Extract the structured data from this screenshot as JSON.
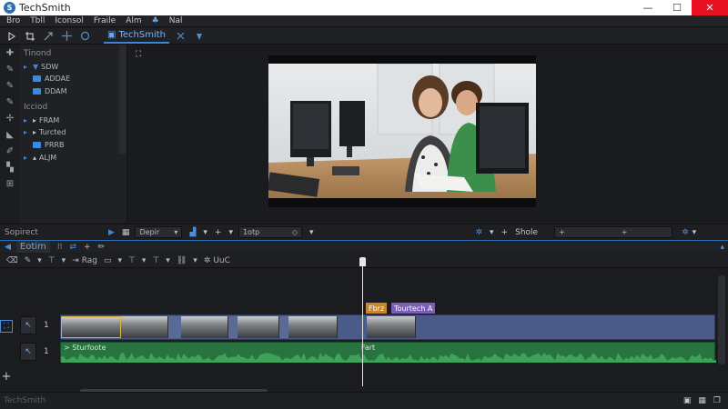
{
  "window": {
    "title": "TechSmith",
    "logo_glyph": "S",
    "controls": {
      "minimize": "—",
      "maximize": "☐",
      "close": "✕"
    }
  },
  "menu": {
    "items": [
      "Bro",
      "Tbll",
      "Iconsol",
      "Fraile",
      "Alm"
    ],
    "extra_icon": "♣",
    "extra_label": "Nal"
  },
  "toolbar": {
    "tab_label": "TechSmith",
    "icons": [
      "arrow-icon",
      "crop-icon",
      "pan-icon",
      "move-icon",
      "zoom-icon"
    ]
  },
  "media_bin": {
    "sections": [
      {
        "label": "Tinond",
        "rows": [
          {
            "label": "SDW",
            "type": "file"
          },
          {
            "label": "ADDAE",
            "type": "folder"
          },
          {
            "label": "DDAM",
            "type": "folder"
          }
        ]
      },
      {
        "label": "Icciod",
        "rows": [
          {
            "label": "FRAM",
            "type": "file"
          },
          {
            "label": "Turcted",
            "type": "file"
          },
          {
            "label": "PRRB",
            "type": "folder"
          },
          {
            "label": "ALJM",
            "type": "file"
          }
        ]
      }
    ]
  },
  "props_bar": {
    "label": "Sopirect",
    "field1": "Depir",
    "field2": "1otp",
    "share_label": "Shole"
  },
  "timeline": {
    "tab_label": "Eotim",
    "toolbar_label_rag": "Rag",
    "toolbar_label_uuc": "UuC",
    "tracks": [
      {
        "number": "1",
        "kind": "video"
      },
      {
        "number": "1",
        "kind": "audio",
        "label": "Sturfoote"
      }
    ],
    "clip_tags": [
      {
        "label": "Fbrz",
        "color": "#c9852b"
      },
      {
        "label": "Tourtech A",
        "color": "#7a5fb4"
      }
    ],
    "audio_marker": "Fart"
  },
  "status": {
    "text": "TechSmith"
  }
}
